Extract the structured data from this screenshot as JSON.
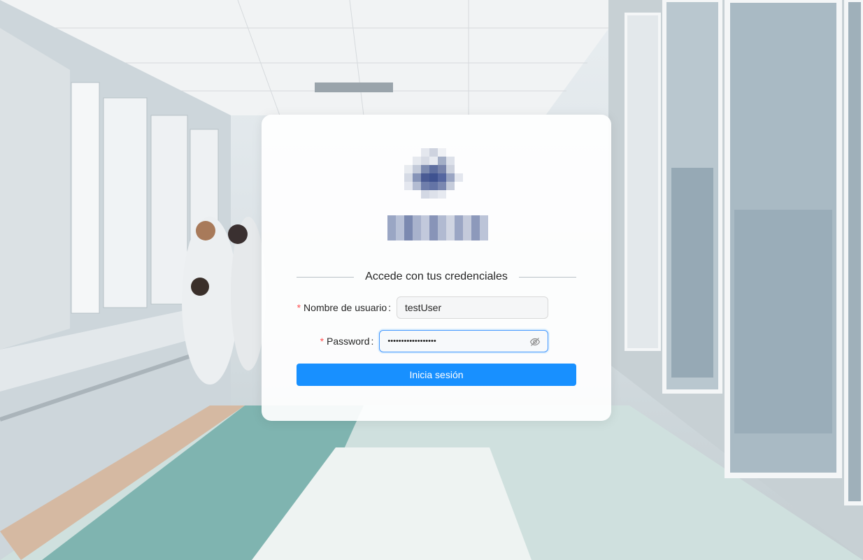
{
  "login": {
    "heading": "Accede con tus credenciales",
    "username": {
      "label": "Nombre de usuario",
      "value": "testUser",
      "required_mark": "*"
    },
    "password": {
      "label": "Password",
      "value": "••••••••••••••••••",
      "required_mark": "*",
      "toggle_icon": "eye-invisible-icon"
    },
    "submit_label": "Inicia sesión"
  },
  "colors": {
    "primary": "#1890ff",
    "required": "#ff4d4f",
    "focus_border": "#4096ff"
  }
}
